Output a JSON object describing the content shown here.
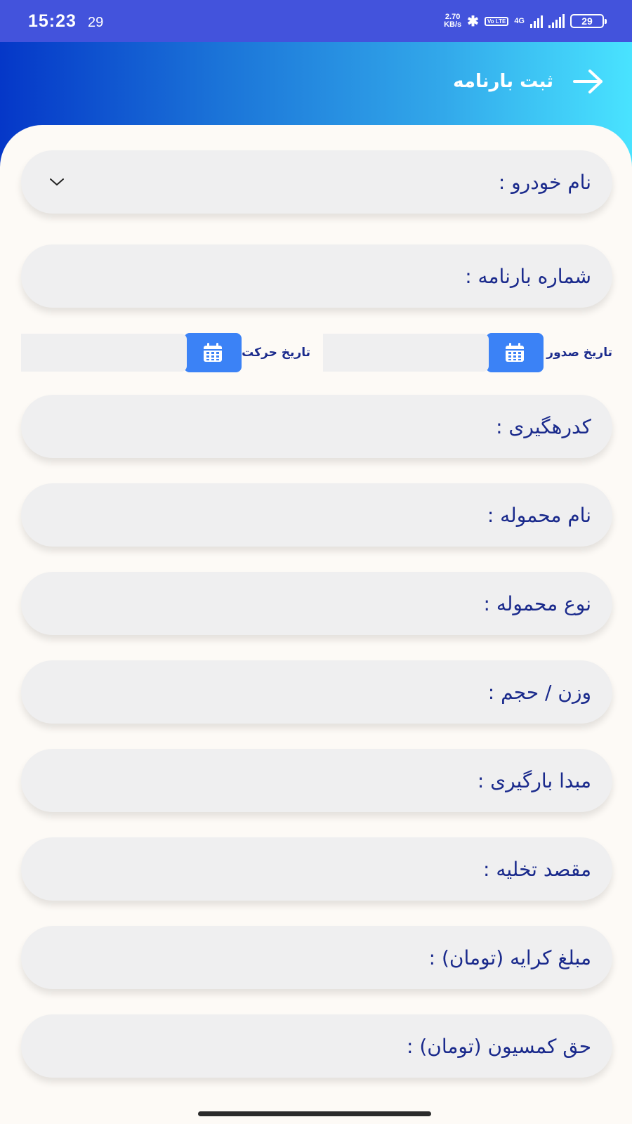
{
  "status_bar": {
    "time": "15:23",
    "extra": "29",
    "net_speed_value": "2.70",
    "net_speed_unit": "KB/s",
    "network": "4G",
    "volte": "Vo LTE",
    "battery": "29"
  },
  "header": {
    "title": "ثبت بارنامه",
    "back_icon": "arrow-right-icon"
  },
  "form": {
    "vehicle_name": "نام خودرو :",
    "bill_number": "شماره بارنامه :",
    "issue_date": "تاریخ صدور",
    "move_date": "تاریخ حرکت",
    "tracking_code": "کدرهگیری :",
    "cargo_name": "نام محموله :",
    "cargo_type": "نوع محموله :",
    "weight_volume": "وزن / حجم :",
    "origin": "مبدا بارگیری :",
    "destination": "مقصد تخلیه :",
    "fare": "مبلغ کرایه (تومان) :",
    "commission": "حق کمسیون (تومان) :"
  },
  "colors": {
    "header_gradient_start": "#0537c8",
    "header_gradient_end": "#49e3ff",
    "status_bar": "#4353dc",
    "label_text": "#1a2a8c",
    "date_button": "#3b82f6",
    "field_background": "#efeff0"
  },
  "icons": {
    "calendar": "calendar-icon",
    "dropdown": "chevron-down-icon"
  }
}
